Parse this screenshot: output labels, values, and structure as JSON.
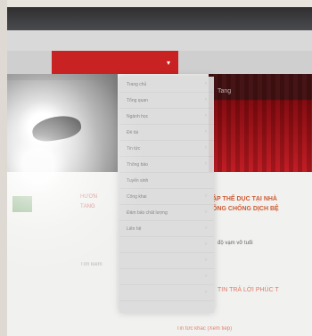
{
  "nav": {
    "items": [
      "",
      "",
      "",
      "",
      "",
      ""
    ],
    "active_index": 1,
    "colors": {
      "bar": "#cfcfcf",
      "active": "#c92222"
    }
  },
  "hero": {
    "right_label": "Tang",
    "caption": ""
  },
  "dropdown": {
    "items": [
      {
        "label": "Trang chủ",
        "has_arrow": true
      },
      {
        "label": "Tổng quan",
        "has_arrow": true
      },
      {
        "label": "Ngành học",
        "has_arrow": true
      },
      {
        "label": "Đề tài",
        "has_arrow": true
      },
      {
        "label": "Tin tức",
        "has_arrow": true
      },
      {
        "label": "Thông báo",
        "has_arrow": true
      },
      {
        "label": "Tuyển sinh",
        "has_arrow": false
      },
      {
        "label": "Công khai",
        "has_arrow": true
      },
      {
        "label": "Đảm bảo chất lượng",
        "has_arrow": true
      },
      {
        "label": "Liên hệ",
        "has_arrow": true
      },
      {
        "label": "",
        "has_arrow": true
      },
      {
        "label": "",
        "has_arrow": true
      },
      {
        "label": "",
        "has_arrow": true
      },
      {
        "label": "",
        "has_arrow": true
      }
    ]
  },
  "content": {
    "title_line1": "ẬP THỂ DỤC TẠI NHÀ",
    "title_line2": "ỐNG CHỐNG DỊCH BỆ",
    "left_fragment_1": "HƯỚN",
    "left_fragment_2": "TĂNG",
    "small_text": "độ vạm vỡ tuổi",
    "section_title": "TIN TRẢ LỜI PHÚC T",
    "footer_text": "Tin tức khác (Xem tiếp)"
  },
  "sidebar": {
    "label_1": "",
    "label_2": "Tìm kiếm",
    "label_3": ""
  }
}
